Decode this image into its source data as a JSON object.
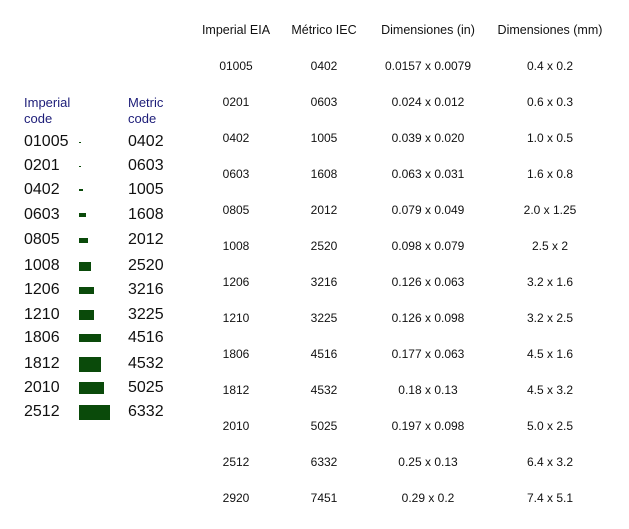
{
  "legend": {
    "imperial_header": "Imperial\ncode",
    "metric_header": "Metric\ncode",
    "swatch_color": "#0a4a0a",
    "rows": [
      {
        "imperial": "01005",
        "metric": "0402"
      },
      {
        "imperial": "0201",
        "metric": "0603"
      },
      {
        "imperial": "0402",
        "metric": "1005"
      },
      {
        "imperial": "0603",
        "metric": "1608"
      },
      {
        "imperial": "0805",
        "metric": "2012"
      },
      {
        "imperial": "1008",
        "metric": "2520"
      },
      {
        "imperial": "1206",
        "metric": "3216"
      },
      {
        "imperial": "1210",
        "metric": "3225"
      },
      {
        "imperial": "1806",
        "metric": "4516"
      },
      {
        "imperial": "1812",
        "metric": "4532"
      },
      {
        "imperial": "2010",
        "metric": "5025"
      },
      {
        "imperial": "2512",
        "metric": "6332"
      }
    ]
  },
  "table": {
    "headers": [
      "Imperial EIA",
      "Métrico IEC",
      "Dimensiones (in)",
      "Dimensiones (mm)"
    ],
    "rows": [
      [
        "01005",
        "0402",
        "0.0157 x 0.0079",
        "0.4 x 0.2"
      ],
      [
        "0201",
        "0603",
        "0.024 x 0.012",
        "0.6 x 0.3"
      ],
      [
        "0402",
        "1005",
        "0.039 x 0.020",
        "1.0 x 0.5"
      ],
      [
        "0603",
        "1608",
        "0.063 x 0.031",
        "1.6 x 0.8"
      ],
      [
        "0805",
        "2012",
        "0.079 x 0.049",
        "2.0 x 1.25"
      ],
      [
        "1008",
        "2520",
        "0.098 x 0.079",
        "2.5 x 2"
      ],
      [
        "1206",
        "3216",
        "0.126 x 0.063",
        "3.2 x 1.6"
      ],
      [
        "1210",
        "3225",
        "0.126 x 0.098",
        "3.2 x 2.5"
      ],
      [
        "1806",
        "4516",
        "0.177 x 0.063",
        "4.5 x 1.6"
      ],
      [
        "1812",
        "4532",
        "0.18 x 0.13",
        "4.5 x 3.2"
      ],
      [
        "2010",
        "5025",
        "0.197 x 0.098",
        "5.0 x 2.5"
      ],
      [
        "2512",
        "6332",
        "0.25 x 0.13",
        "6.4 x 3.2"
      ],
      [
        "2920",
        "7451",
        "0.29 x 0.2",
        "7.4 x 5.1"
      ]
    ]
  }
}
